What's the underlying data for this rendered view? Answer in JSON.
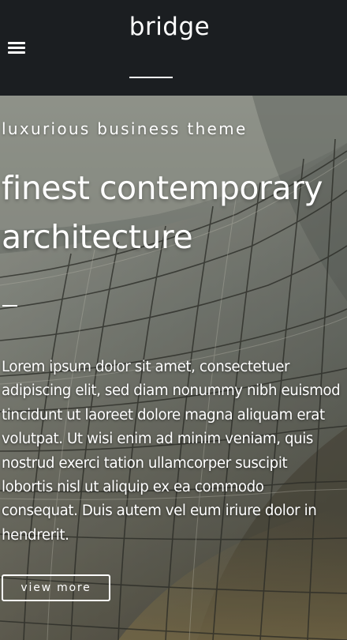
{
  "header": {
    "menu_icon": "hamburger-icon",
    "logo_text": "bridge",
    "background_color": "#1b1e21"
  },
  "hero": {
    "subtitle": "luxurious business theme",
    "headline": "finest contemporary architecture",
    "body": "Lorem ipsum dolor sit amet, consectetuer adipiscing elit, sed diam nonummy nibh euismod tincidunt ut laoreet dolore magna aliquam erat volutpat. Ut wisi enim ad minim veniam, quis nostrud exerci tation ullamcorper suscipit lobortis nisl ut aliquip ex ea commodo consequat. Duis autem vel eum iriure dolor in hendrerit.",
    "button_label": "view more",
    "text_color": "#ffffff"
  }
}
